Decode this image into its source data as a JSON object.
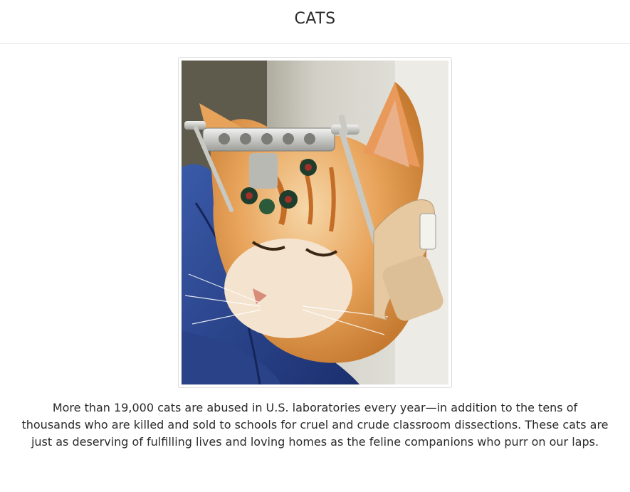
{
  "header": {
    "title": "CATS"
  },
  "photo": {
    "subject": "orange-cat-with-stereotaxic-head-device"
  },
  "caption": {
    "text": "More than 19,000 cats are abused in U.S. laboratories every year—in addition to the tens of thousands who are killed and sold to schools for cruel and crude classroom dissections. These cats are just as deserving of fulfilling lives and loving homes as the feline companions who purr on our laps."
  },
  "colors": {
    "text": "#2b2b2b",
    "divider": "#e3e3e3",
    "background": "#ffffff"
  }
}
